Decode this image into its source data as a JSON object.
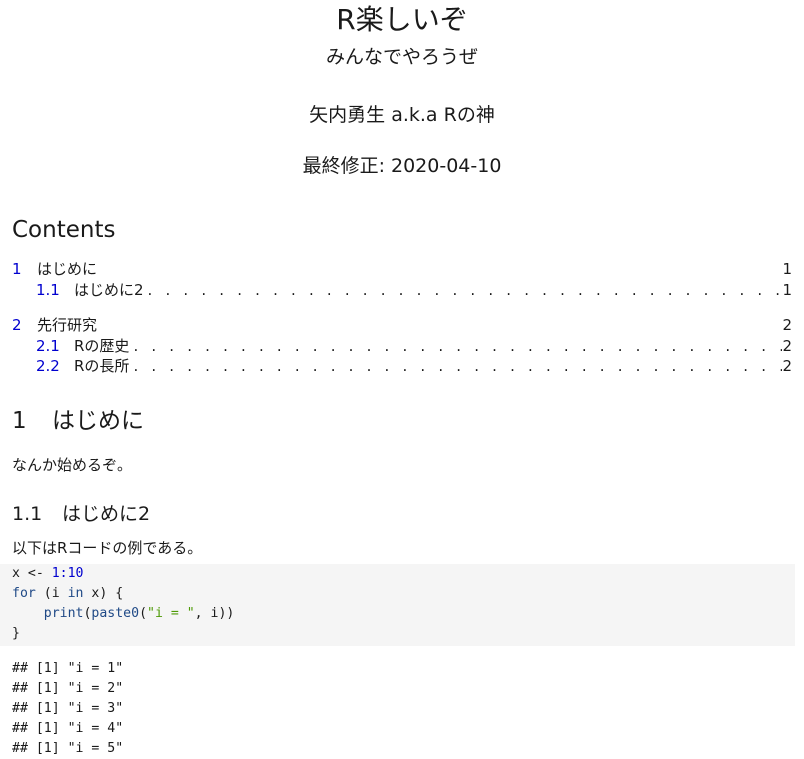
{
  "document": {
    "title": "R楽しいぞ",
    "subtitle": "みんなでやろうぜ",
    "author": "矢内勇生 a.k.a Rの神",
    "date": "最終修正: 2020-04-10"
  },
  "toc": {
    "heading": "Contents",
    "entries": [
      {
        "number": "1",
        "label": "はじめに",
        "page": "1"
      },
      {
        "number": "1.1",
        "label": "はじめに2",
        "page": "1"
      },
      {
        "number": "2",
        "label": "先行研究",
        "page": "2"
      },
      {
        "number": "2.1",
        "label": "Rの歴史",
        "page": "2"
      },
      {
        "number": "2.2",
        "label": "Rの長所",
        "page": "2"
      }
    ]
  },
  "section1": {
    "number": "1",
    "title": "はじめに",
    "paragraph": "なんか始めるぞ。"
  },
  "subsection11": {
    "number": "1.1",
    "title": "はじめに2",
    "paragraph": "以下はRコードの例である。"
  },
  "code": {
    "lines": [
      [
        "x <- ",
        "1",
        ":",
        "10"
      ],
      [
        "for",
        " (i ",
        "in",
        " x) {"
      ],
      [
        "    ",
        "print",
        "(",
        "paste0",
        "(",
        "\"i = \"",
        ", i))"
      ],
      [
        "}"
      ]
    ]
  },
  "output": {
    "lines": [
      "## [1] \"i = 1\"",
      "## [1] \"i = 2\"",
      "## [1] \"i = 3\"",
      "## [1] \"i = 4\"",
      "## [1] \"i = 5\""
    ]
  }
}
